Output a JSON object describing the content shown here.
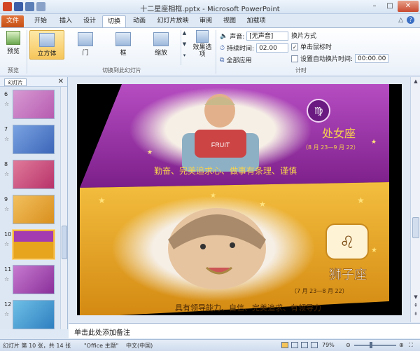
{
  "window": {
    "title": "十二星座相框.pptx - Microsoft PowerPoint",
    "controls": [
      "–",
      "□",
      "✕"
    ]
  },
  "tabs": [
    {
      "label": "文件",
      "active": false,
      "file": true
    },
    {
      "label": "开始",
      "active": false
    },
    {
      "label": "插入",
      "active": false
    },
    {
      "label": "设计",
      "active": false
    },
    {
      "label": "切换",
      "active": true
    },
    {
      "label": "动画",
      "active": false
    },
    {
      "label": "幻灯片放映",
      "active": false
    },
    {
      "label": "审阅",
      "active": false
    },
    {
      "label": "视图",
      "active": false
    },
    {
      "label": "加载项",
      "active": false
    }
  ],
  "ribbon": {
    "preview": {
      "label": "预览",
      "group": "预览"
    },
    "transitions": {
      "items": [
        "立方体",
        "门",
        "框",
        "缩放"
      ],
      "selected": "立方体",
      "group": "切换到此幻灯片",
      "effect_options": "效果选项"
    },
    "timing": {
      "sound_label": "声音:",
      "sound_value": "[无声音]",
      "duration_label": "持续时间:",
      "duration_value": "02.00",
      "apply_all": "全部应用",
      "advance_title": "换片方式",
      "on_click_label": "单击鼠标时",
      "on_click_checked": true,
      "after_label": "设置自动换片时间:",
      "after_value": "00:00.00",
      "after_checked": false,
      "group": "计时"
    }
  },
  "thumbnails": {
    "numbers": [
      "6",
      "7",
      "8",
      "9",
      "10",
      "11",
      "12"
    ],
    "selected": "10",
    "star": "☆",
    "tab_label": "幻灯片"
  },
  "slide": {
    "top_sign": "处女座",
    "top_dates": "（8 月 23—9 月 22）",
    "top_motto": "勤奋、完美追求心、做事有条理、谨慎",
    "front_sign": "狮子座",
    "front_dates": "（7 月 23—8 月 22）",
    "front_motto": "具有领导能力、自信、完美追求、有领导力",
    "shirt_text": "FRUIT",
    "colors": {
      "top": "#9a2aa8",
      "front": "#e6a51d",
      "bg": "#000000"
    }
  },
  "notes_placeholder": "单击此处添加备注",
  "status": {
    "slide_info": "幻灯片 第 10 张，共 14 张",
    "theme": "\"Office 主题\"",
    "language": "中文(中国)",
    "zoom": "79%"
  }
}
